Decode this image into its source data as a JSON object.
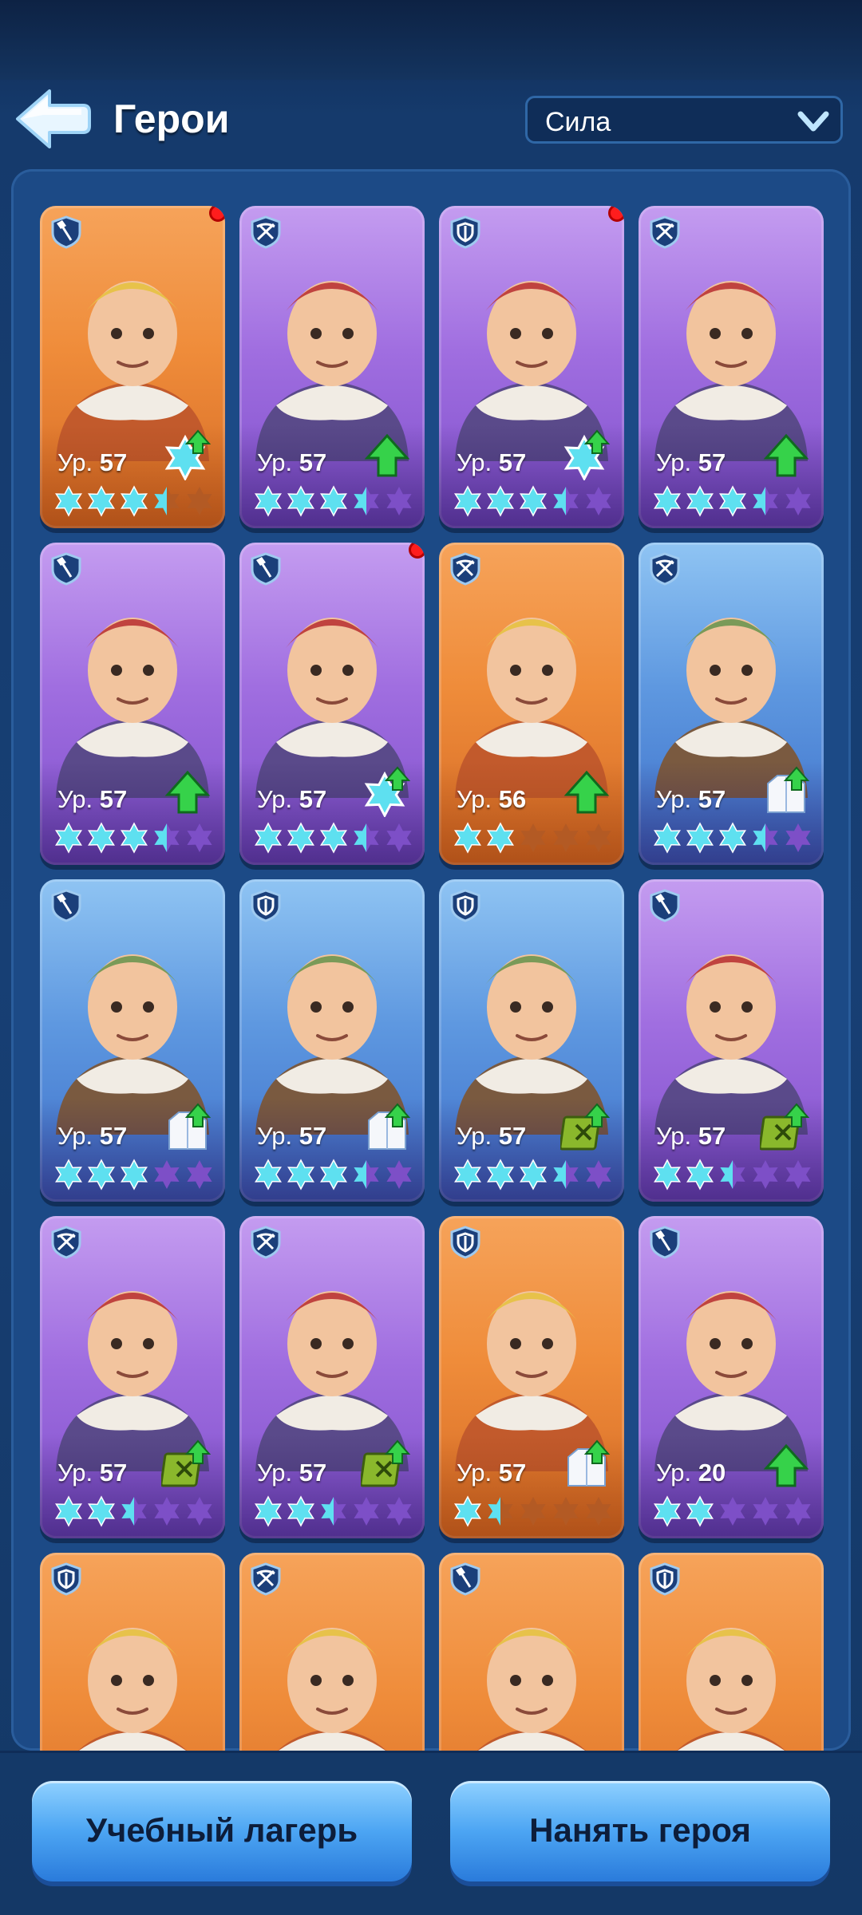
{
  "header": {
    "title": "Герои",
    "sort_value": "Сила"
  },
  "level_prefix": "Ур.",
  "colors": {
    "orange_card": "#ef8c3a",
    "purple_card": "#a06ee0",
    "blue_card": "#5e98e0",
    "star_filled": "#5ee0f0",
    "star_empty_purple": "#7d4fc7",
    "star_empty_orange": "#b35a24",
    "upgrade_arrow": "#36d24a",
    "notification_dot": "#ff1d1d",
    "button": "#4ca5f3"
  },
  "heroes": [
    {
      "bg": "orange",
      "role": "shovel",
      "level": "57",
      "badge": "snowflake",
      "stars": 3.5,
      "dot": true
    },
    {
      "bg": "purple",
      "role": "crossbow",
      "level": "57",
      "badge": "arrow",
      "stars": 3.5,
      "dot": false
    },
    {
      "bg": "purple",
      "role": "shield",
      "level": "57",
      "badge": "snowflake",
      "stars": 3.5,
      "dot": true
    },
    {
      "bg": "purple",
      "role": "crossbow",
      "level": "57",
      "badge": "arrow",
      "stars": 3.5,
      "dot": false
    },
    {
      "bg": "purple",
      "role": "shovel",
      "level": "57",
      "badge": "arrow",
      "stars": 3.5,
      "dot": false
    },
    {
      "bg": "purple",
      "role": "shovel",
      "level": "57",
      "badge": "snowflake",
      "stars": 3.5,
      "dot": true
    },
    {
      "bg": "orange",
      "role": "crossbow",
      "level": "56",
      "badge": "arrow",
      "stars": 2,
      "dot": false
    },
    {
      "bg": "blue",
      "role": "crossbow",
      "level": "57",
      "badge": "coat",
      "stars": 3.5,
      "dot": false
    },
    {
      "bg": "blue",
      "role": "shovel",
      "level": "57",
      "badge": "coat",
      "stars": 3,
      "dot": false
    },
    {
      "bg": "blue",
      "role": "shield",
      "level": "57",
      "badge": "coat",
      "stars": 3.5,
      "dot": false
    },
    {
      "bg": "blue",
      "role": "shield",
      "level": "57",
      "badge": "manual",
      "stars": 3.5,
      "dot": false
    },
    {
      "bg": "purple",
      "role": "shovel",
      "level": "57",
      "badge": "manual",
      "stars": 2.5,
      "dot": false
    },
    {
      "bg": "purple",
      "role": "crossbow",
      "level": "57",
      "badge": "manual",
      "stars": 2.5,
      "dot": false
    },
    {
      "bg": "purple",
      "role": "crossbow",
      "level": "57",
      "badge": "manual",
      "stars": 2.5,
      "dot": false
    },
    {
      "bg": "orange",
      "role": "shield",
      "level": "57",
      "badge": "coat",
      "stars": 1.5,
      "dot": false
    },
    {
      "bg": "purple",
      "role": "shovel",
      "level": "20",
      "badge": "arrow",
      "stars": 2,
      "dot": false
    },
    {
      "bg": "orange",
      "role": "shield",
      "level": "",
      "badge": "",
      "stars": 0,
      "dot": false
    },
    {
      "bg": "orange",
      "role": "crossbow",
      "level": "",
      "badge": "",
      "stars": 0,
      "dot": false
    },
    {
      "bg": "orange",
      "role": "shovel",
      "level": "",
      "badge": "",
      "stars": 0,
      "dot": false
    },
    {
      "bg": "orange",
      "role": "shield",
      "level": "",
      "badge": "",
      "stars": 0,
      "dot": false
    }
  ],
  "buttons": {
    "training": "Учебный лагерь",
    "recruit": "Нанять героя"
  }
}
